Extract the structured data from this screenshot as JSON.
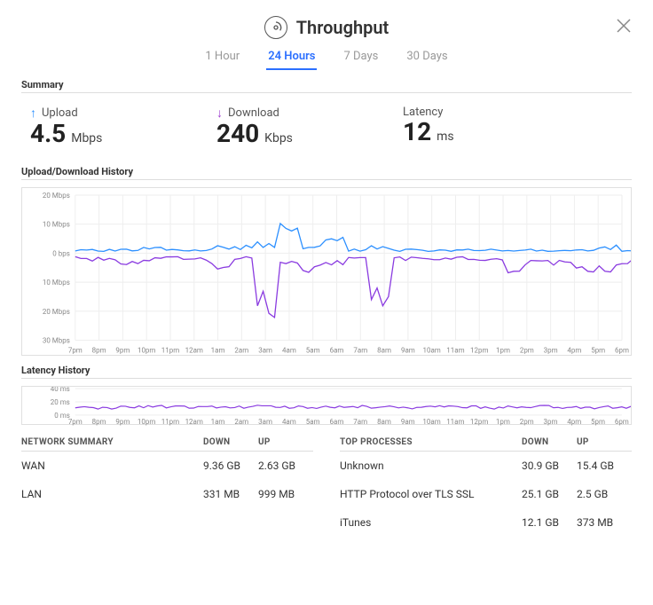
{
  "header": {
    "title": "Throughput"
  },
  "tabs": [
    "1 Hour",
    "24 Hours",
    "7 Days",
    "30 Days"
  ],
  "active_tab": 1,
  "sections": {
    "summary": "Summary",
    "history": "Upload/Download History",
    "latency": "Latency History"
  },
  "summary": {
    "upload": {
      "label": "Upload",
      "value": "4.5",
      "unit": "Mbps"
    },
    "download": {
      "label": "Download",
      "value": "240",
      "unit": "Kbps"
    },
    "latency": {
      "label": "Latency",
      "value": "12",
      "unit": "ms"
    }
  },
  "network_table": {
    "title": "NETWORK SUMMARY",
    "cols": [
      "DOWN",
      "UP"
    ],
    "rows": [
      {
        "name": "WAN",
        "down": "9.36 GB",
        "up": "2.63 GB"
      },
      {
        "name": "LAN",
        "down": "331 MB",
        "up": "999 MB"
      }
    ]
  },
  "process_table": {
    "title": "TOP PROCESSES",
    "cols": [
      "DOWN",
      "UP"
    ],
    "rows": [
      {
        "name": "Unknown",
        "down": "30.9 GB",
        "up": "15.4 GB"
      },
      {
        "name": "HTTP Protocol over TLS SSL",
        "down": "25.1 GB",
        "up": "2.5 GB"
      },
      {
        "name": "iTunes",
        "down": "12.1 GB",
        "up": "373 MB"
      }
    ]
  },
  "chart_data": {
    "history": {
      "type": "area-mirror",
      "x_labels": [
        "7pm",
        "8pm",
        "9pm",
        "10pm",
        "11pm",
        "12am",
        "1am",
        "2am",
        "3am",
        "4am",
        "5am",
        "6am",
        "7am",
        "8am",
        "9am",
        "10am",
        "11am",
        "12pm",
        "1pm",
        "2pm",
        "3pm",
        "4pm",
        "5pm",
        "6pm"
      ],
      "y_labels_up": [
        "0 bps",
        "10 Mbps",
        "20 Mbps"
      ],
      "y_labels_down": [
        "10 Mbps",
        "20 Mbps",
        "30 Mbps"
      ],
      "y_range_up": [
        0,
        20
      ],
      "y_range_down": [
        0,
        30
      ],
      "series": [
        {
          "name": "Upload",
          "color": "#2b8fff",
          "values": [
            1,
            1,
            1,
            2,
            1,
            1,
            2,
            2,
            3,
            8,
            2,
            4,
            1,
            2,
            1,
            1,
            1,
            1,
            1,
            1,
            1,
            1,
            1,
            2,
            1
          ]
        },
        {
          "name": "Download",
          "color": "#8a3be0",
          "values": [
            2,
            2,
            3,
            2,
            2,
            2,
            4,
            2,
            18,
            3,
            5,
            3,
            2,
            14,
            2,
            2,
            2,
            2,
            2,
            5,
            2,
            4,
            6,
            5,
            3
          ]
        }
      ]
    },
    "latency": {
      "type": "line",
      "x_labels": [
        "7pm",
        "8pm",
        "9pm",
        "10pm",
        "11pm",
        "12am",
        "1am",
        "2am",
        "3am",
        "4am",
        "5am",
        "6am",
        "7am",
        "8am",
        "9am",
        "10am",
        "11am",
        "12pm",
        "1pm",
        "2pm",
        "3pm",
        "4pm",
        "5pm",
        "6pm"
      ],
      "y_labels": [
        "0 ms",
        "20 ms",
        "40 ms"
      ],
      "y_range": [
        0,
        40
      ],
      "series": [
        {
          "name": "Latency",
          "color": "#8a3be0",
          "values": [
            12,
            11,
            12,
            13,
            12,
            11,
            12,
            12,
            13,
            12,
            11,
            12,
            13,
            12,
            11,
            12,
            13,
            12,
            11,
            12,
            13,
            12,
            11,
            12,
            12
          ]
        }
      ]
    }
  }
}
